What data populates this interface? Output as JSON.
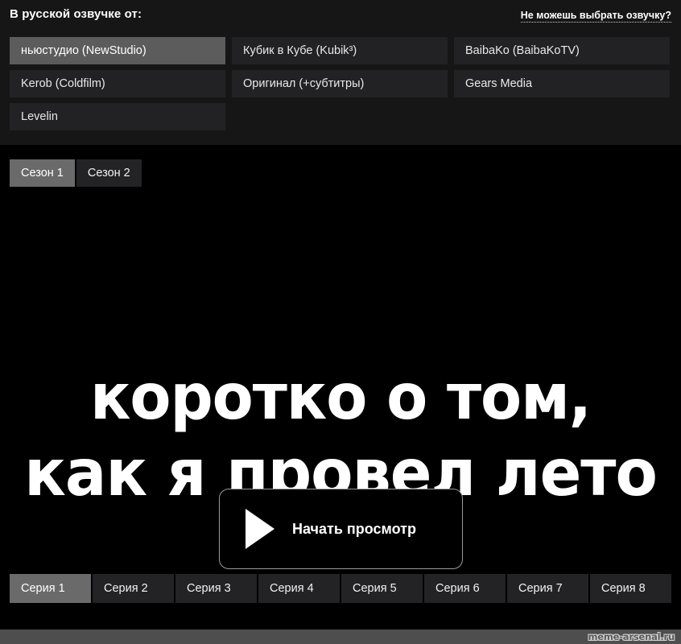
{
  "voice_panel": {
    "header": "В русской озвучке от:",
    "help_link": "Не можешь выбрать озвучку?",
    "options": [
      {
        "label": "ньюстудио (NewStudio)",
        "selected": true
      },
      {
        "label": "Кубик в Кубе (Kubik³)",
        "selected": false
      },
      {
        "label": "BaibaKo (BaibaKoTV)",
        "selected": false
      },
      {
        "label": "Kerob (Coldfilm)",
        "selected": false
      },
      {
        "label": "Оригинал (+субтитры)",
        "selected": false
      },
      {
        "label": "Gears Media",
        "selected": false
      },
      {
        "label": "Levelin",
        "selected": false
      }
    ]
  },
  "player": {
    "seasons": [
      {
        "label": "Сезон 1",
        "active": true
      },
      {
        "label": "Сезон 2",
        "active": false
      }
    ],
    "meme_text": {
      "line1": "коротко о том,",
      "line2": "как я провел лето"
    },
    "start_button": {
      "label": "Начать просмотр",
      "icon": "play-icon"
    },
    "episodes": [
      {
        "label": "Серия 1",
        "active": true
      },
      {
        "label": "Серия 2",
        "active": false
      },
      {
        "label": "Серия 3",
        "active": false
      },
      {
        "label": "Серия 4",
        "active": false
      },
      {
        "label": "Серия 5",
        "active": false
      },
      {
        "label": "Серия 6",
        "active": false
      },
      {
        "label": "Серия 7",
        "active": false
      },
      {
        "label": "Серия 8",
        "active": false
      }
    ]
  },
  "footer": {
    "watermark": "meme-arsenal.ru"
  },
  "colors": {
    "panel_bg": "#161616",
    "player_bg": "#000000",
    "item_bg": "#222224",
    "item_selected_bg": "#5c5c5c",
    "tab_bg": "#232325",
    "tab_active_bg": "#6a6a6a",
    "footer_bg": "#4e4e4e",
    "text": "#ffffff"
  }
}
